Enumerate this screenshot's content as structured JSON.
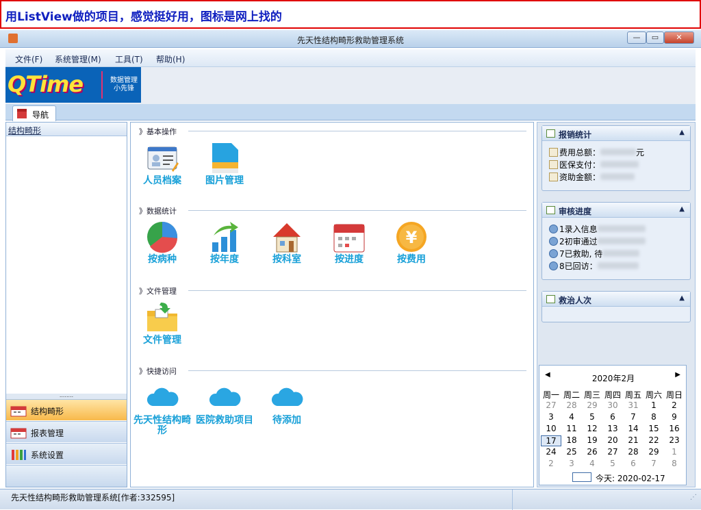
{
  "banner": {
    "caption": "用ListView做的项目，感觉挺好用，图标是网上找的"
  },
  "window": {
    "title": "先天性结构畸形救助管理系统",
    "controls": {
      "minimize": "—",
      "maximize": "▭",
      "close": "✕"
    }
  },
  "menu": [
    "文件(F)",
    "系统管理(M)",
    "工具(T)",
    "帮助(H)"
  ],
  "logo": {
    "brand": "QTime",
    "subtitle_1": "数据管理",
    "subtitle_2": "小先锋"
  },
  "tab": {
    "label": "导航"
  },
  "sidebar": {
    "tree_head": "结构畸形",
    "grip": "........",
    "buttons": [
      "结构畸形",
      "报表管理",
      "系统设置"
    ]
  },
  "sections": [
    {
      "title": "基本操作",
      "items": [
        {
          "label": "人员档案",
          "icon": "id-card-icon"
        },
        {
          "label": "图片管理",
          "icon": "sd-card-icon"
        }
      ]
    },
    {
      "title": "数据统计",
      "items": [
        {
          "label": "按病种",
          "icon": "pie-chart-icon"
        },
        {
          "label": "按年度",
          "icon": "bar-chart-icon"
        },
        {
          "label": "按科室",
          "icon": "house-icon"
        },
        {
          "label": "按进度",
          "icon": "calendar-icon"
        },
        {
          "label": "按费用",
          "icon": "yen-coin-icon"
        }
      ]
    },
    {
      "title": "文件管理",
      "items": [
        {
          "label": "文件管理",
          "icon": "folder-icon"
        }
      ]
    },
    {
      "title": "快捷访问",
      "items": [
        {
          "label": "先天性结构畸形",
          "icon": "cloud-icon"
        },
        {
          "label": "医院救助项目",
          "icon": "cloud-icon"
        },
        {
          "label": "待添加",
          "icon": "cloud-icon"
        }
      ]
    }
  ],
  "panels": {
    "claims": {
      "title": "报销统计",
      "rows": [
        "费用总额：",
        "医保支付：",
        "资助金额："
      ],
      "unit": "元"
    },
    "review": {
      "title": "审核进度",
      "rows": [
        "1录入信息",
        "2初审通过",
        "7已救助, 待",
        "8已回访："
      ]
    },
    "treat": {
      "title": "救治人次"
    }
  },
  "calendar": {
    "month": "2020年2月",
    "prev": "◀",
    "next": "▶",
    "weekdays": [
      "周一",
      "周二",
      "周三",
      "周四",
      "周五",
      "周六",
      "周日"
    ],
    "weeks": [
      [
        "27",
        "28",
        "29",
        "30",
        "31",
        "1",
        "2"
      ],
      [
        "3",
        "4",
        "5",
        "6",
        "7",
        "8",
        "9"
      ],
      [
        "10",
        "11",
        "12",
        "13",
        "14",
        "15",
        "16"
      ],
      [
        "17",
        "18",
        "19",
        "20",
        "21",
        "22",
        "23"
      ],
      [
        "24",
        "25",
        "26",
        "27",
        "28",
        "29",
        "1"
      ],
      [
        "2",
        "3",
        "4",
        "5",
        "6",
        "7",
        "8"
      ]
    ],
    "today_label": "今天: 2020-02-17",
    "selected": "17"
  },
  "status": {
    "text": "先天性结构畸形救助管理系统[作者:332595]"
  },
  "colors": {
    "accent": "#18a0d8",
    "title_blue": "#1020c0",
    "panel_bg": "#dfe7f1"
  }
}
